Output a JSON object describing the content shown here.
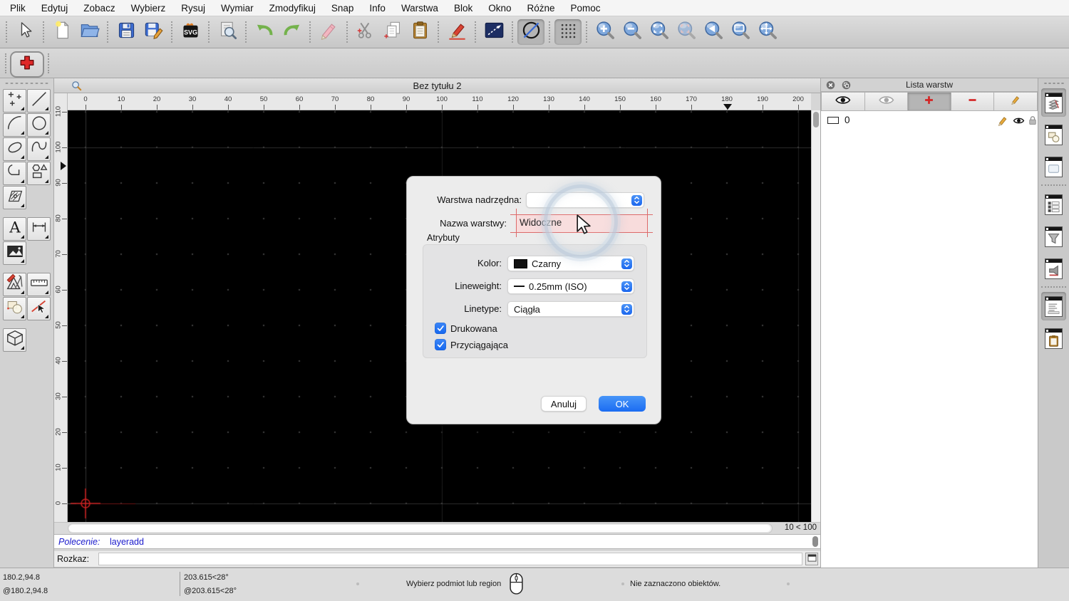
{
  "menu_bar": {
    "items": [
      "Plik",
      "Edytuj",
      "Zobacz",
      "Wybierz",
      "Rysuj",
      "Wymiar",
      "Zmodyfikuj",
      "Snap",
      "Info",
      "Warstwa",
      "Blok",
      "Okno",
      "Różne",
      "Pomoc"
    ]
  },
  "main_toolbar": {
    "groups": [
      [
        "pointer"
      ],
      [
        "file-new",
        "file-open"
      ],
      [
        "file-save",
        "file-save-as"
      ],
      [
        "svg-export"
      ],
      [
        "print-preview"
      ],
      [
        "undo",
        "redo"
      ],
      [
        "erase"
      ],
      [
        "cut",
        "copy",
        "paste"
      ],
      [
        "pen-edit"
      ],
      [
        "line-shortcut"
      ],
      [
        "circle-shortcut"
      ],
      [
        "grid-toggle"
      ],
      [
        "zoom-in",
        "zoom-out",
        "zoom-auto",
        "zoom-selection",
        "zoom-previous",
        "zoom-window",
        "zoom-pan"
      ]
    ],
    "active": [
      "circle-shortcut",
      "grid-toggle"
    ]
  },
  "options_toolbar": {
    "buttons": [
      {
        "icon": "add-plus",
        "active": true
      }
    ]
  },
  "left_toolbar": {
    "rows": [
      [
        "points",
        "line"
      ],
      [
        "arc",
        "circle"
      ],
      [
        "ellipse",
        "spline"
      ],
      [
        "polyline",
        "shapes"
      ],
      [
        "hatch"
      ],
      "gap",
      [
        "text",
        "dimension"
      ],
      [
        "image"
      ],
      "gap",
      [
        "draft",
        "measure"
      ],
      [
        "blocks",
        "modify"
      ],
      "gap",
      [
        "solid"
      ]
    ]
  },
  "document_window": {
    "title": "Bez tytułu 2",
    "grid_status": "10 < 100"
  },
  "rulers": {
    "h_labels": [
      0,
      10,
      20,
      30,
      40,
      50,
      60,
      70,
      80,
      90,
      100,
      110,
      120,
      130,
      140,
      150,
      160,
      170,
      180,
      190,
      200
    ],
    "v_labels": [
      0,
      10,
      20,
      30,
      40,
      50,
      60,
      70,
      80,
      90,
      100,
      110
    ],
    "h_marker": 180.2,
    "v_marker": 94.8
  },
  "canvas": {
    "origin_units": [
      0,
      0
    ],
    "grid_spacing_units": 10,
    "meta_grid_units": 100
  },
  "dialog": {
    "parent_layer_label": "Warstwa nadrzędna:",
    "layer_name_label": "Nazwa warstwy:",
    "layer_name_value": "Widoczne",
    "attributes_label": "Atrybuty",
    "color_label": "Kolor:",
    "color_value": "Czarny",
    "lineweight_label": "Lineweight:",
    "lineweight_value": "0.25mm (ISO)",
    "linetype_label": "Linetype:",
    "linetype_value": "Ciągła",
    "checkbox_printable": {
      "label": "Drukowana",
      "checked": true
    },
    "checkbox_snappable": {
      "label": "Przyciągająca",
      "checked": true
    },
    "cancel_label": "Anuluj",
    "ok_label": "OK"
  },
  "layer_panel": {
    "title": "Lista warstw",
    "toolbar": [
      {
        "icon": "eye-show"
      },
      {
        "icon": "eye-hide",
        "disabled": true
      },
      {
        "icon": "plus",
        "active": true
      },
      {
        "icon": "minus"
      },
      {
        "icon": "pencil"
      }
    ],
    "layers": [
      {
        "name": "0",
        "icons": [
          "pencil",
          "eye-small",
          "lock"
        ]
      }
    ]
  },
  "right_dock_strip": {
    "buttons": [
      {
        "icon": "layer-list-window",
        "active": true
      },
      {
        "icon": "block-list-window"
      },
      {
        "icon": "library-window"
      },
      "sep",
      {
        "icon": "property-editor-window"
      },
      {
        "icon": "filter-window"
      },
      {
        "icon": "pen-settings-window"
      },
      "sep",
      {
        "icon": "command-window",
        "active": true
      },
      {
        "icon": "clipboard-window"
      }
    ]
  },
  "command_area": {
    "history_label": "Polecenie:",
    "history_command": "layeradd",
    "prompt_label": "Rozkaz:",
    "input_value": ""
  },
  "status_bar": {
    "coord_abs": "180.2,94.8",
    "coord_rel": "@180.2,94.8",
    "polar_abs": "203.615<28°",
    "polar_rel": "@203.615<28°",
    "hint": "Wybierz podmiot lub region",
    "selection_info": "Nie zaznaczono obiektów."
  },
  "colors": {
    "accent_blue": "#1b6cf2",
    "highlight_red": "#dd6a6a",
    "field_pink": "#f8dcdc",
    "canvas_black": "#000000",
    "command_blue": "#1a1acc"
  }
}
